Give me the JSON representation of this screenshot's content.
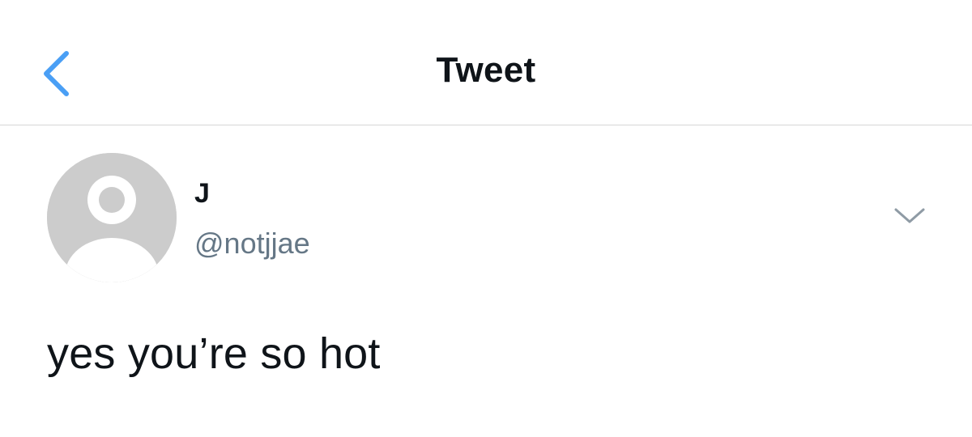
{
  "header": {
    "title": "Tweet",
    "back_icon": "chevron-left-icon"
  },
  "tweet": {
    "author": {
      "display_name": "J",
      "handle": "@notjjae",
      "avatar_icon": "default-avatar-icon"
    },
    "text": "yes you’re so hot",
    "menu_icon": "chevron-down-icon"
  },
  "colors": {
    "accent": "#4a9ff5",
    "text_primary": "#0f1419",
    "text_secondary": "#657786",
    "divider": "#d6d6d6",
    "avatar_bg": "#cccccc"
  }
}
